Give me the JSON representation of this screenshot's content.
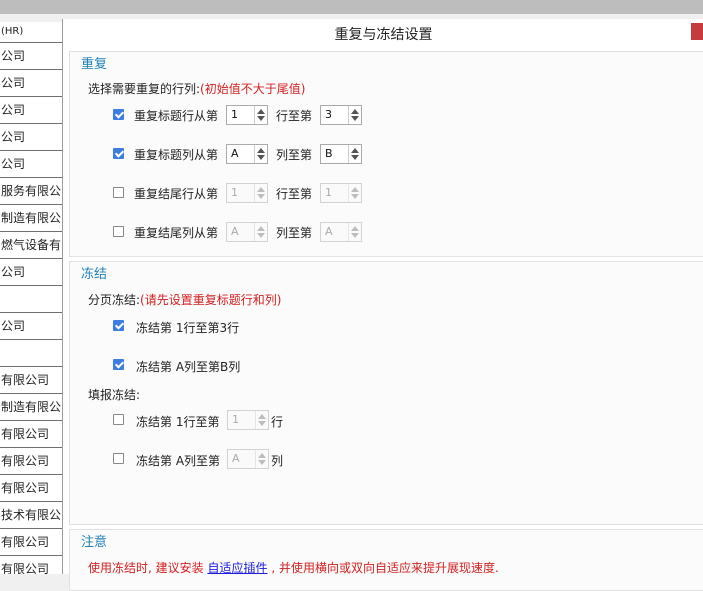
{
  "left_column": {
    "header": "(HR)",
    "rows": [
      "公司",
      "公司",
      "公司",
      "公司",
      "公司",
      "服务有限公",
      "制造有限公",
      "燃气设备有",
      "公司",
      "",
      "公司",
      "",
      "有限公司",
      "制造有限公",
      "有限公司",
      "有限公司",
      "有限公司",
      "技术有限公",
      "有限公司",
      "有限公司"
    ]
  },
  "dialog": {
    "title": "重复与冻结设置",
    "repeat": {
      "section_title": "重复",
      "prompt": "选择需要重复的行列:",
      "prompt_note": "(初始值不大于尾值)",
      "rows": [
        {
          "label": "重复标题行从第",
          "checked": true,
          "from": "1",
          "mid": "行至第",
          "to": "3"
        },
        {
          "label": "重复标题列从第",
          "checked": true,
          "from": "A",
          "mid": "列至第",
          "to": "B"
        },
        {
          "label": "重复结尾行从第",
          "checked": false,
          "from": "1",
          "mid": "行至第",
          "to": "1"
        },
        {
          "label": "重复结尾列从第",
          "checked": false,
          "from": "A",
          "mid": "列至第",
          "to": "A"
        }
      ]
    },
    "freeze": {
      "section_title": "冻结",
      "page_label": "分页冻结:",
      "page_note": "(请先设置重复标题行和列)",
      "page_rows": [
        {
          "label": "冻结第 1行至第3行",
          "checked": true
        },
        {
          "label": "冻结第 A列至第B列",
          "checked": true
        }
      ],
      "fill_label": "填报冻结:",
      "fill_rows": [
        {
          "label": "冻结第 1行至第",
          "checked": false,
          "value": "1",
          "suffix": "行"
        },
        {
          "label": "冻结第 A列至第",
          "checked": false,
          "value": "A",
          "suffix": "列"
        }
      ]
    },
    "note": {
      "section_title": "注意",
      "text_before": "使用冻结时, 建议安装",
      "link": "自适应插件",
      "text_after": ", 并使用横向或双向自适应来提升展现速度."
    }
  },
  "colors": {
    "section_title": "#1d7fb6",
    "note_red": "#d42020",
    "checkbox": "#3c7de0",
    "link": "#1a1adc",
    "close": "#c43d3d"
  }
}
